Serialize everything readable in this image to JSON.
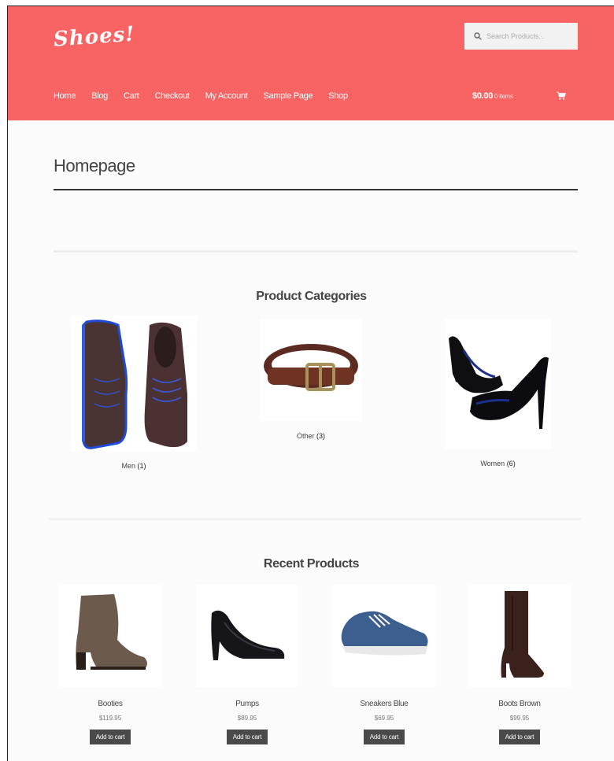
{
  "header": {
    "logo_text": "Shoes!",
    "search_placeholder": "Search Products...",
    "nav": [
      "Home",
      "Blog",
      "Cart",
      "Checkout",
      "My Account",
      "Sample Page",
      "Shop"
    ],
    "cart_total": "$0.00",
    "cart_items": "0 items"
  },
  "page": {
    "title": "Homepage"
  },
  "categories": {
    "title": "Product Categories",
    "items": [
      {
        "name": "Men",
        "count": "(1)"
      },
      {
        "name": "Other",
        "count": "(3)"
      },
      {
        "name": "Women",
        "count": "(6)"
      }
    ]
  },
  "recent": {
    "title": "Recent Products",
    "button_label": "Add to cart",
    "items": [
      {
        "name": "Booties",
        "price": "$119.95"
      },
      {
        "name": "Pumps",
        "price": "$89.95"
      },
      {
        "name": "Sneakers Blue",
        "price": "$69.95"
      },
      {
        "name": "Boots Brown",
        "price": "$99.95"
      }
    ]
  },
  "colors": {
    "header_bg": "#f86464",
    "button_bg": "#4a4a4a"
  }
}
